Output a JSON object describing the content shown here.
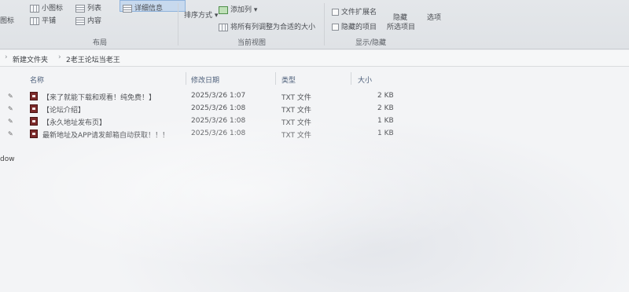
{
  "ribbon": {
    "view_options": {
      "small_icons": "小图标",
      "list": "列表",
      "details": "详细信息",
      "tiles": "平铺",
      "content": "内容",
      "left_partial_top": "图标",
      "left_partial_bottom": ""
    },
    "sort_by": "排序方式",
    "add_columns": "添加列",
    "size_all_columns": "将所有列调整为合适的大小",
    "file_extensions": "文件扩展名",
    "hidden_items": "隐藏的项目",
    "hide_selected": "所选项目",
    "hide": "隐藏",
    "options": "选项",
    "groups": {
      "layout": "布局",
      "current_view": "当前视图",
      "show_hide": "显示/隐藏"
    }
  },
  "breadcrumb": {
    "items": [
      "新建文件夹",
      "2老王论坛当老王"
    ],
    "separator": "›"
  },
  "columns": {
    "name": "名称",
    "modified": "修改日期",
    "type": "类型",
    "size": "大小"
  },
  "files": [
    {
      "name": "【来了就能下载和观看！纯免费！】",
      "modified": "2025/3/26 1:07",
      "type": "TXT 文件",
      "size": "2 KB"
    },
    {
      "name": "【论坛介绍】",
      "modified": "2025/3/26 1:08",
      "type": "TXT 文件",
      "size": "2 KB"
    },
    {
      "name": "【永久地址发布页】",
      "modified": "2025/3/26 1:08",
      "type": "TXT 文件",
      "size": "1 KB"
    },
    {
      "name": "最新地址及APP请发邮箱自动获取！！！",
      "modified": "2025/3/26 1:08",
      "type": "TXT 文件",
      "size": "1 KB"
    }
  ],
  "sidebar_partial": "dow",
  "pin_glyph": "✎"
}
